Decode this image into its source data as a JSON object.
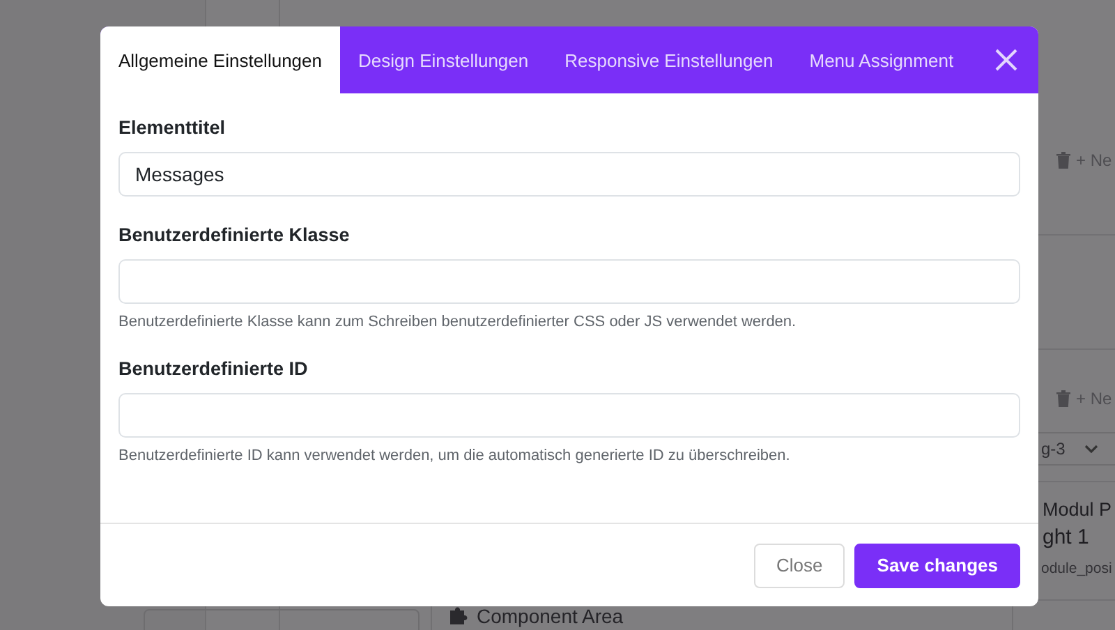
{
  "background": {
    "right_panel": {
      "actions": [
        {
          "label": "+ Ne"
        },
        {
          "label": "+ Ne"
        }
      ],
      "select_value": "g-3",
      "module_title": "Modul P",
      "module_subtitle": "ght 1",
      "module_position": "odule_posi"
    },
    "component_area": "Component Area"
  },
  "dialog": {
    "tabs": [
      {
        "label": "Allgemeine Einstellungen",
        "selected": true
      },
      {
        "label": "Design Einstellungen",
        "selected": false
      },
      {
        "label": "Responsive Einstellungen",
        "selected": false
      },
      {
        "label": "Menu Assignment",
        "selected": false
      }
    ],
    "fields": [
      {
        "label": "Elementtitel",
        "value": "Messages"
      },
      {
        "label": "Benutzerdefinierte Klasse",
        "help": "Benutzerdefinierte Klasse kann zum Schreiben benutzerdefinierter CSS oder JS verwendet werden."
      },
      {
        "label": "Benutzerdefinierte ID",
        "help": "Benutzerdefinierte ID kann verwendet werden, um die automatisch generierte ID zu überschreiben."
      }
    ],
    "buttons": [
      {
        "label": "Close",
        "kind": "secondary"
      },
      {
        "label": "Save changes",
        "kind": "primary"
      }
    ]
  }
}
